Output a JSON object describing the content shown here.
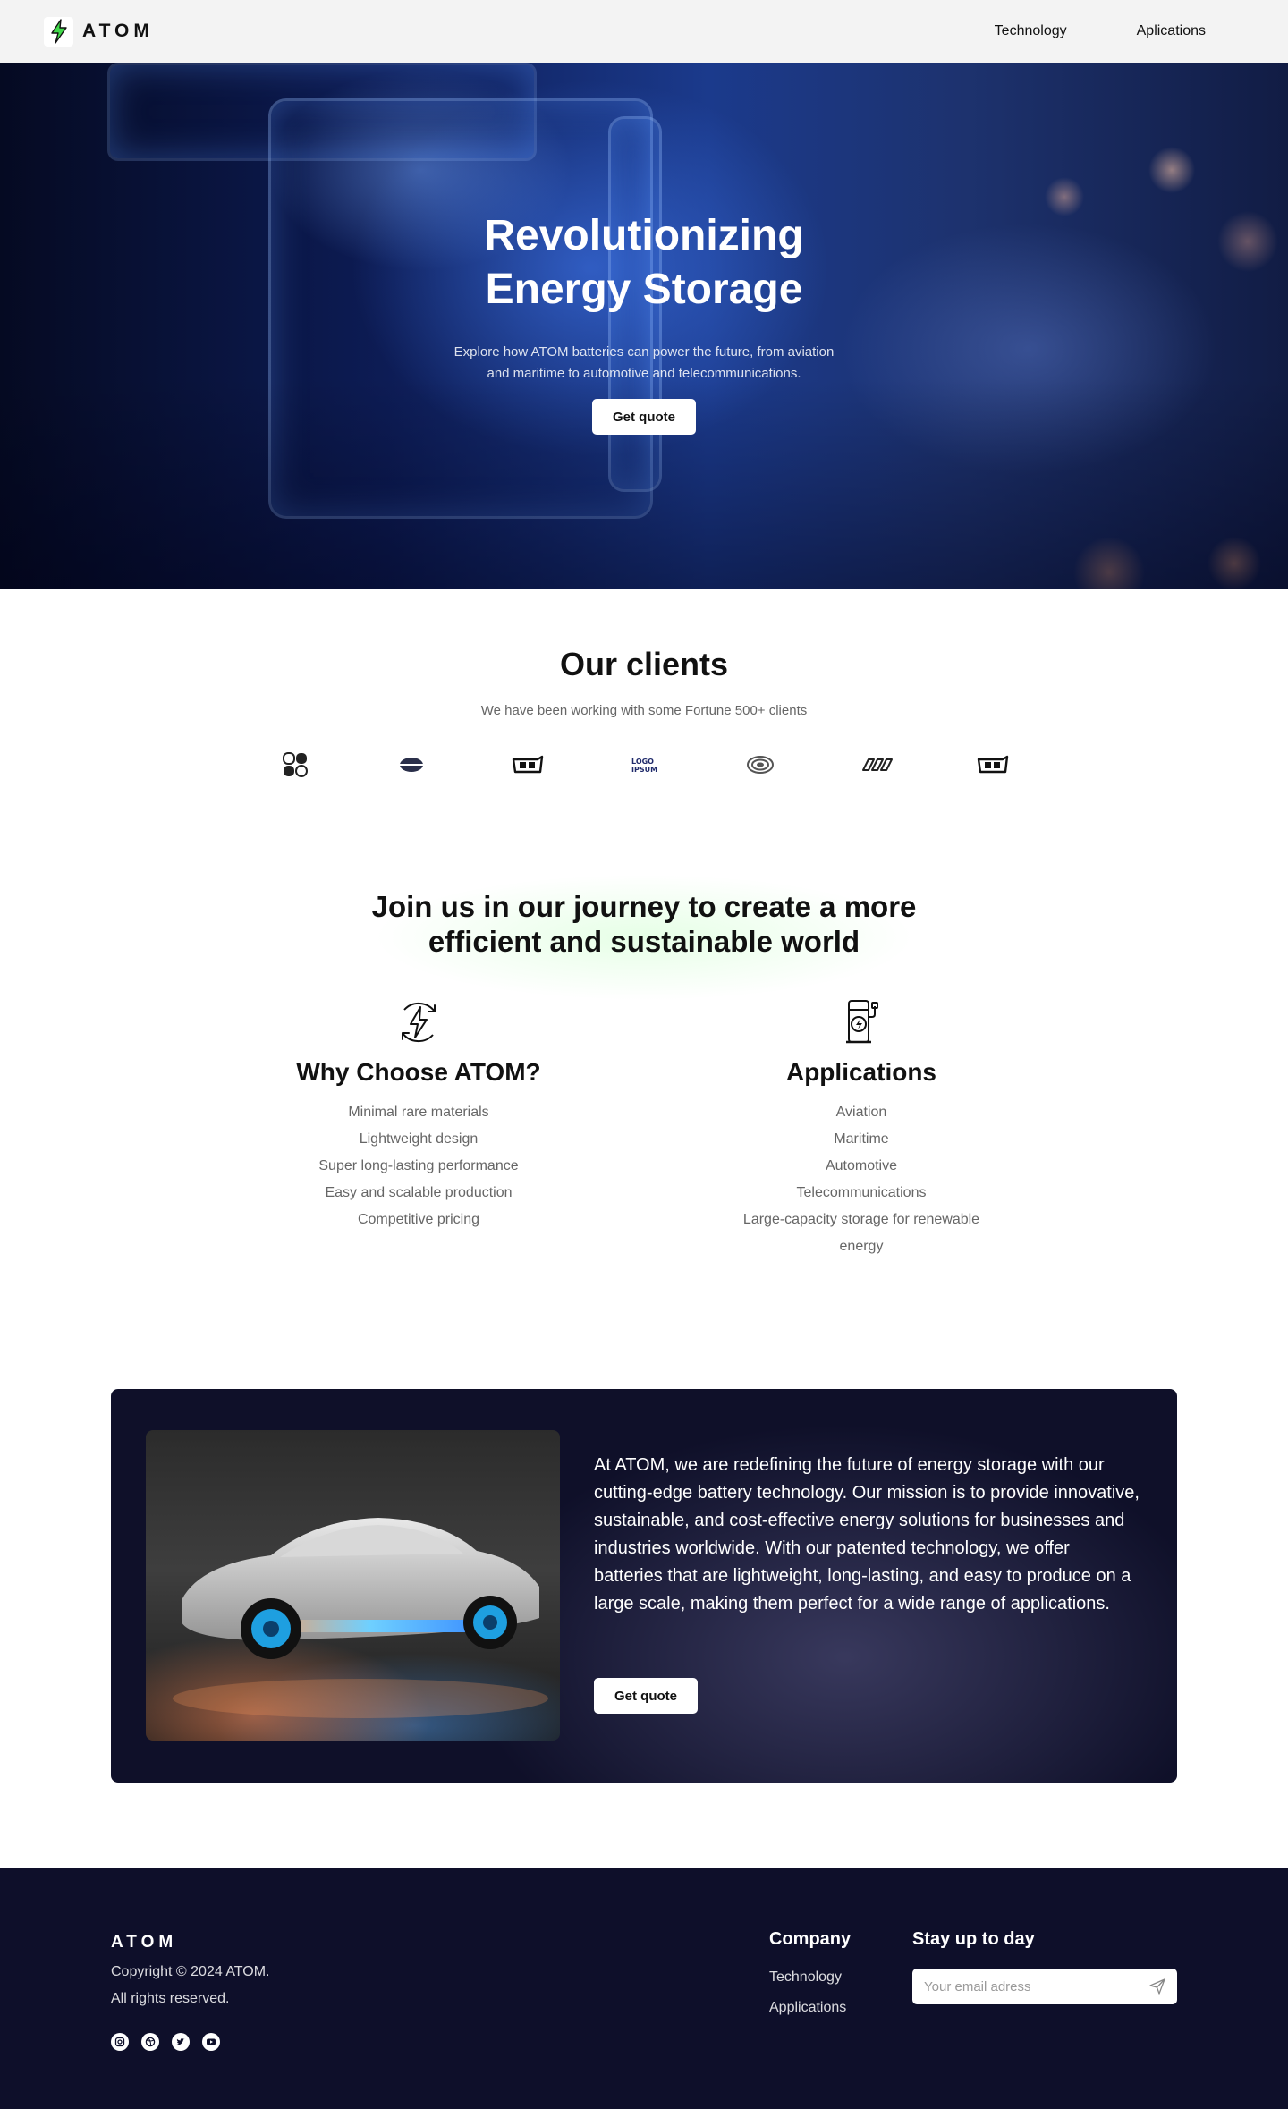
{
  "header": {
    "brand": "ATOM",
    "nav": [
      "Technology",
      "Aplications"
    ]
  },
  "hero": {
    "title_line1": "Revolutionizing",
    "title_line2": "Energy Storage",
    "subtitle_line1": "Explore how ATOM batteries can power the future, from aviation",
    "subtitle_line2": "and maritime to automotive and telecommunications.",
    "cta": "Get quote"
  },
  "clients": {
    "title": "Our clients",
    "subtitle": "We have been working with some Fortune 500+ clients",
    "logos": [
      "client-logo-1",
      "client-logo-2",
      "client-logo-3",
      "client-logo-4",
      "client-logo-5",
      "client-logo-6",
      "client-logo-7"
    ]
  },
  "journey": {
    "title_line1": "Join us in our journey to create a more",
    "title_line2": "efficient and sustainable world",
    "why": {
      "icon": "lightning-cycle-icon",
      "title": "Why Choose ATOM?",
      "items": [
        "Minimal rare materials",
        "Lightweight design",
        "Super long-lasting performance",
        "Easy and scalable production",
        "Competitive pricing"
      ]
    },
    "applications": {
      "icon": "charging-station-icon",
      "title": "Applications",
      "items": [
        "Aviation",
        "Maritime",
        "Automotive",
        "Telecommunications",
        "Large-capacity storage for renewable",
        "energy"
      ]
    }
  },
  "about": {
    "text": "At ATOM, we are redefining the future of energy storage with our cutting-edge battery technology. Our mission is to provide innovative, sustainable, and cost-effective energy solutions for businesses and industries worldwide. With our patented technology, we offer batteries that are lightweight, long-lasting, and easy to produce on a large scale, making them perfect for a wide range of applications.",
    "cta": "Get quote"
  },
  "footer": {
    "brand": "ATOM",
    "copyright": "Copyright © 2024 ATOM.",
    "rights": "All rights reserved.",
    "socials": [
      "instagram-icon",
      "dribbble-icon",
      "twitter-icon",
      "youtube-icon"
    ],
    "company_title": "Company",
    "company_links": [
      "Technology",
      "Applications"
    ],
    "newsletter_title": "Stay up to day",
    "email_placeholder": "Your email adress"
  }
}
